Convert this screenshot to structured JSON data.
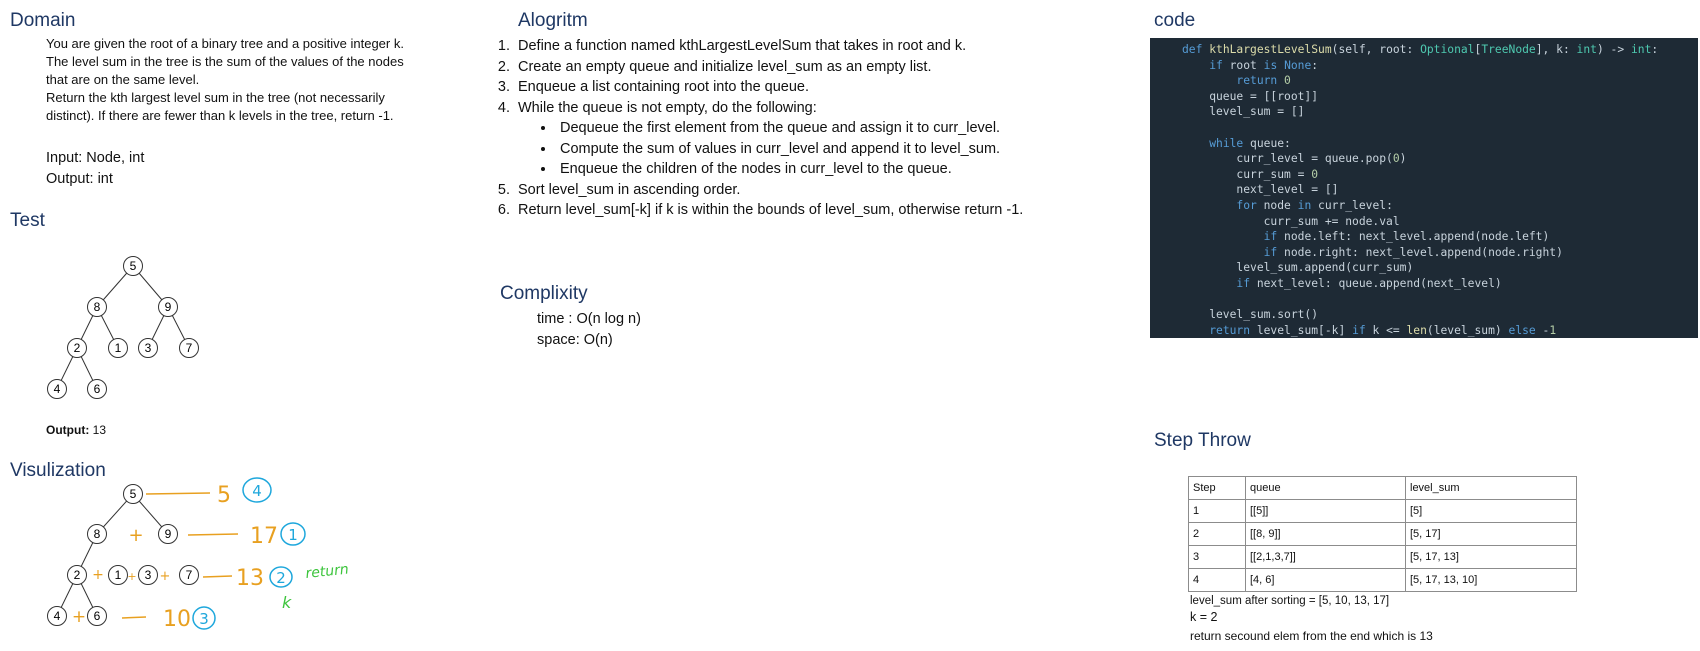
{
  "domain": {
    "heading": "Domain",
    "lines": [
      "You are given the root of a binary tree and a positive integer k.",
      "The level sum in the tree is the sum of the values of the nodes",
      "that are on the same level.",
      "Return the kth largest level sum in the tree (not necessarily",
      "distinct). If there are fewer than k levels in the tree, return -1."
    ],
    "input": "Input: Node, int",
    "output": "Output: int"
  },
  "test": {
    "heading": "Test",
    "nodes": [
      "5",
      "8",
      "9",
      "2",
      "1",
      "3",
      "7",
      "4",
      "6"
    ],
    "output_label": "Output:",
    "output_value": "13"
  },
  "visualization": {
    "heading": "Visulization",
    "nodes": [
      "5",
      "8",
      "9",
      "2",
      "1",
      "3",
      "7",
      "4",
      "6"
    ],
    "sums": [
      "5",
      "17",
      "13",
      "10"
    ],
    "ranks": [
      "4",
      "1",
      "2",
      "3"
    ],
    "note": "return",
    "k_mark": "k",
    "plus": "+"
  },
  "algorithm": {
    "heading": "Alogritm",
    "steps": [
      "Define a function named kthLargestLevelSum that takes in root and k.",
      "Create an empty queue and initialize level_sum as an empty list.",
      "Enqueue a list containing root into the queue.",
      "While the queue is not empty, do the following:",
      "Sort level_sum in ascending order.",
      "Return level_sum[-k] if k is within the bounds of level_sum, otherwise return -1."
    ],
    "substeps": [
      "Dequeue the first element from the queue and assign it to curr_level.",
      "Compute the sum of values in curr_level and append it to level_sum.",
      "Enqueue the children of the nodes in curr_level to the queue."
    ]
  },
  "complexity": {
    "heading": "Complixity",
    "time": "time : O(n log n)",
    "space": "space: O(n)"
  },
  "code": {
    "heading": "code"
  },
  "step_through": {
    "heading": "Step Throw",
    "columns": [
      "Step",
      "queue",
      "level_sum"
    ],
    "rows": [
      [
        "1",
        "[[5]]",
        "[5]"
      ],
      [
        "2",
        "[[8, 9]]",
        "[5, 17]"
      ],
      [
        "3",
        "[[2,1,3,7]]",
        "[5, 17, 13]"
      ],
      [
        "4",
        "[4, 6]",
        "[5, 17, 13, 10]"
      ]
    ],
    "after_sort": "level_sum after sorting = [5, 10, 13, 17]",
    "k_line": "k = 2",
    "result_line": "return secound elem from the end which is 13"
  },
  "colors": {
    "heading": "#1f3864",
    "code_bg": "#1e2a35",
    "annotation_orange": "#e8a020",
    "annotation_blue": "#1ea7dc",
    "annotation_green": "#3cc43c"
  }
}
